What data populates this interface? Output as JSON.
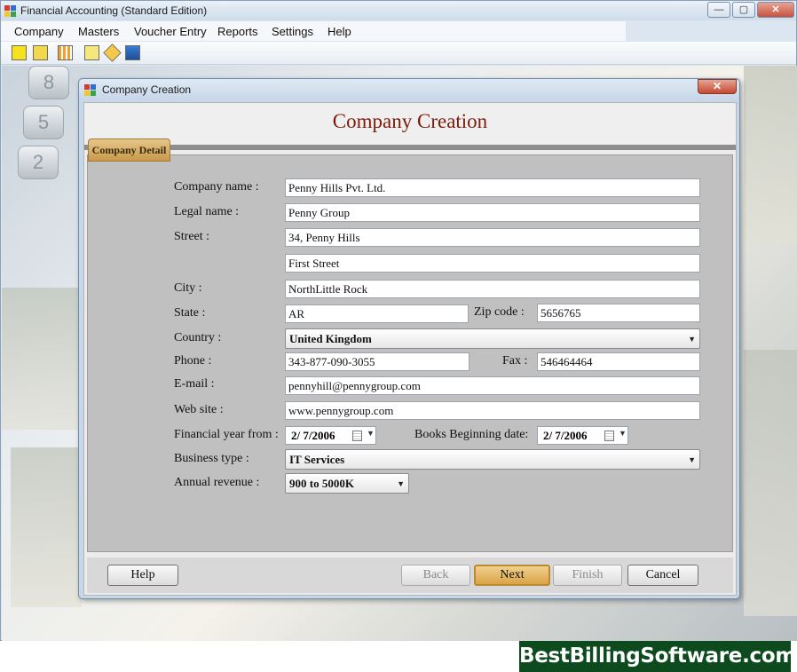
{
  "app": {
    "title": "Financial Accounting (Standard Edition)",
    "window_buttons": {
      "minimize": "—",
      "maximize": "▢",
      "close": "✕"
    }
  },
  "menu": {
    "items": [
      "Company",
      "Masters",
      "Voucher Entry",
      "Reports",
      "Settings",
      "Help"
    ]
  },
  "toolbar": {
    "icons": [
      "new-company-icon",
      "open-company-icon",
      "ledger-icon",
      "voucher-icon",
      "edit-icon",
      "report-icon"
    ]
  },
  "background": {
    "calc_keys": [
      "8",
      "5",
      "2"
    ]
  },
  "dialog": {
    "title": "Company Creation",
    "close_label": "✕",
    "heading": "Company Creation",
    "tab": "Company Detail",
    "form": {
      "company_name": {
        "label": "Company name :",
        "value": "Penny Hills Pvt. Ltd."
      },
      "legal_name": {
        "label": "Legal name :",
        "value": "Penny Group"
      },
      "street": {
        "label": "Street :",
        "value1": "34, Penny Hills",
        "value2": "First Street"
      },
      "city": {
        "label": "City :",
        "value": "NorthLittle Rock"
      },
      "state": {
        "label": "State :",
        "value": "AR"
      },
      "zip": {
        "label": "Zip code :",
        "value": "5656765"
      },
      "country": {
        "label": "Country :",
        "value": "United Kingdom"
      },
      "phone": {
        "label": "Phone :",
        "value": "343-877-090-3055"
      },
      "fax": {
        "label": "Fax :",
        "value": "546464464"
      },
      "email": {
        "label": "E-mail :",
        "value": "pennyhill@pennygroup.com"
      },
      "website": {
        "label": "Web site :",
        "value": "www.pennygroup.com"
      },
      "fy_from": {
        "label": "Financial year from :",
        "value": "2/  7/2006"
      },
      "books_begin": {
        "label": "Books Beginning date:",
        "value": "2/  7/2006"
      },
      "business_type": {
        "label": "Business type :",
        "value": "IT Services"
      },
      "annual_revenue": {
        "label": "Annual revenue :",
        "value": "900 to 5000K"
      }
    },
    "buttons": {
      "help": "Help",
      "back": "Back",
      "next": "Next",
      "finish": "Finish",
      "cancel": "Cancel"
    }
  },
  "brand": {
    "text": "BestBillingSoftware.com"
  },
  "colors": {
    "heading": "#7a1a0a",
    "tab": "#d9a347",
    "brand_bg": "#0d4a1e"
  }
}
